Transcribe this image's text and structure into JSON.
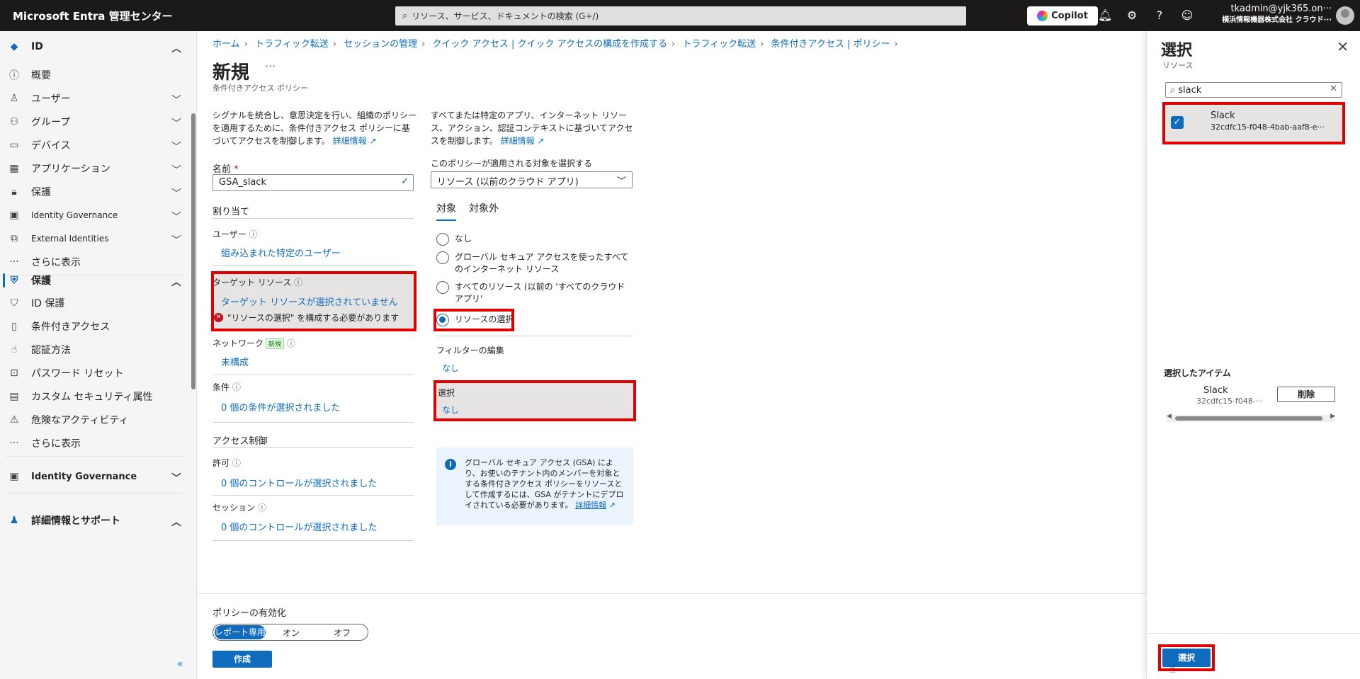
{
  "app": {
    "brand": "Microsoft Entra 管理センター",
    "search_placeholder": "リソース、サービス、ドキュメントの検索 (G+/)",
    "copilot": "Copilot",
    "account_name": "tkadmin@yjk365.on···",
    "account_org": "横浜情報機器株式会社 クラウド···"
  },
  "sidebar": {
    "sec1": {
      "label": "ID",
      "items": [
        "概要",
        "ユーザー",
        "グループ",
        "デバイス",
        "アプリケーション",
        "保護",
        "Identity Governance",
        "External Identities",
        "さらに表示"
      ]
    },
    "sec2": {
      "label": "保護",
      "items": [
        "ID 保護",
        "条件付きアクセス",
        "認証方法",
        "パスワード リセット",
        "カスタム セキュリティ属性",
        "危険なアクティビティ",
        "さらに表示"
      ]
    },
    "sec3": {
      "label": "Identity Governance"
    },
    "sec4": {
      "label": "詳細情報とサポート"
    }
  },
  "breadcrumb": [
    "ホーム",
    "トラフィック転送",
    "セッションの管理",
    "クイック アクセス | クイック アクセスの構成を作成する",
    "トラフィック転送",
    "条件付きアクセス | ポリシー"
  ],
  "page": {
    "title": "新規",
    "subtitle": "条件付きアクセス ポリシー"
  },
  "left": {
    "desc": "シグナルを統合し、意思決定を行い、組織のポリシーを適用するために、条件付きアクセス ポリシーに基づいてアクセスを制御します。",
    "desc_link": "詳細情報",
    "name_label": "名前",
    "name_required": "*",
    "name_value": "GSA_slack",
    "assign_header": "割り当て",
    "users_label": "ユーザー",
    "users_value": "組み込まれた特定のユーザー",
    "target_label": "ターゲット リソース",
    "target_value": "ターゲット リソースが選択されていません",
    "target_error": "\"リソースの選択\" を構成する必要があります",
    "network_label": "ネットワーク",
    "network_badge": "新規",
    "network_value": "未構成",
    "conditions_label": "条件",
    "conditions_value": "0 個の条件が選択されました",
    "access_header": "アクセス制御",
    "grant_label": "許可",
    "grant_value": "0 個のコントロールが選択されました",
    "session_label": "セッション",
    "session_value": "0 個のコントロールが選択されました"
  },
  "right": {
    "desc": "すべてまたは特定のアプリ、インターネット リソース、アクション、認証コンテキストに基づいてアクセスを制御します。",
    "desc_link": "詳細情報",
    "apply_label": "このポリシーが適用される対象を選択する",
    "apply_value": "リソース (以前のクラウド アプリ)",
    "tab_include": "対象",
    "tab_exclude": "対象外",
    "radio": [
      "なし",
      "グローバル セキュア アクセスを使ったすべてのインターネット リソース",
      "すべてのリソース (以前の 'すべてのクラウド アプリ'",
      "リソースの選択"
    ],
    "filter_label": "フィルターの編集",
    "filter_value": "なし",
    "select_label": "選択",
    "select_value": "なし",
    "info": "グローバル セキュア アクセス (GSA) により、お使いのテナント内のメンバーを対象とする条件付きアクセス ポリシーをリソースとして作成するには、GSA がテナントにデプロイされている必要があります。",
    "info_link": "詳細情報"
  },
  "footer": {
    "enable_label": "ポリシーの有効化",
    "options": [
      "レポート専用",
      "オン",
      "オフ"
    ],
    "create": "作成"
  },
  "panel": {
    "title": "選択",
    "subtitle": "リソース",
    "search_value": "slack",
    "result_name": "Slack",
    "result_id": "32cdfc15-f048-4bab-aaf8-e···",
    "selected_label": "選択したアイテム",
    "selected_name": "Slack",
    "selected_id": "32cdfc15-f048-···",
    "delete": "削除",
    "select_button": "選択"
  }
}
